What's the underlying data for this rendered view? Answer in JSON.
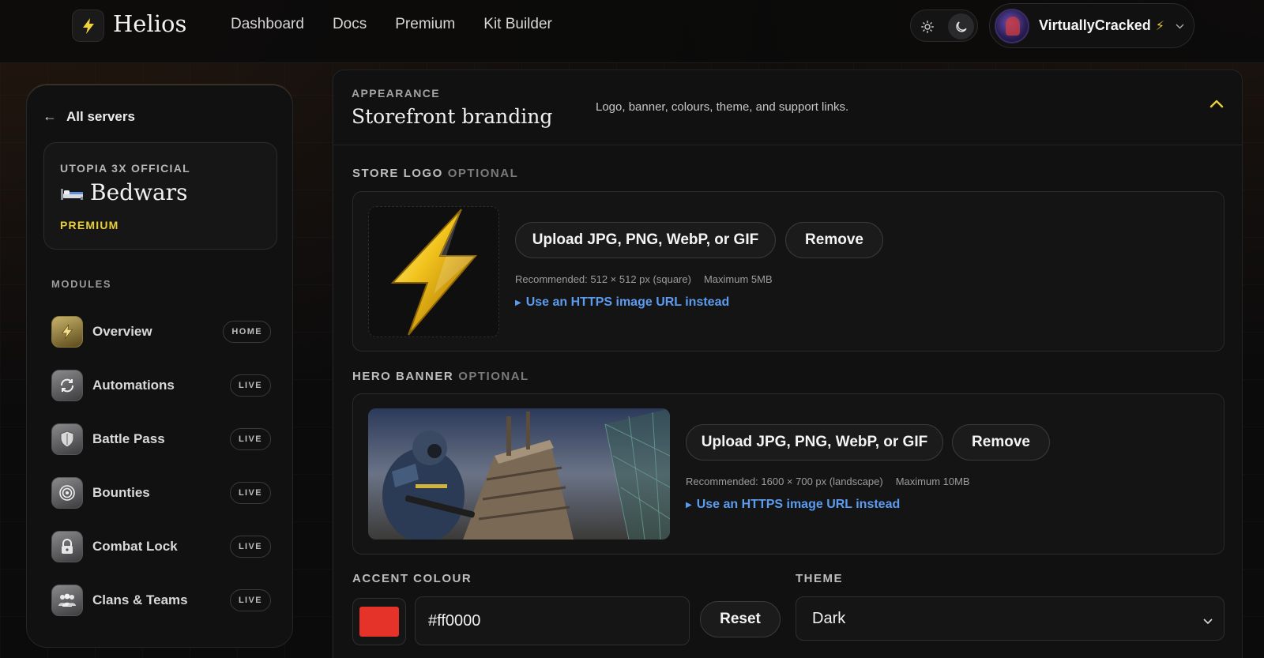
{
  "app": {
    "name": "Helios"
  },
  "nav": {
    "items": [
      "Dashboard",
      "Docs",
      "Premium",
      "Kit Builder"
    ]
  },
  "user": {
    "name": "VirtuallyCracked",
    "badge": "⚡"
  },
  "sidebar": {
    "back_label": "All servers",
    "server": {
      "org": "UTOPIA 3X OFFICIAL",
      "name": "Bedwars",
      "tier": "PREMIUM"
    },
    "modules_label": "MODULES",
    "modules": [
      {
        "label": "Overview",
        "badge": "HOME",
        "icon": "bolt-icon"
      },
      {
        "label": "Automations",
        "badge": "LIVE",
        "icon": "refresh-icon"
      },
      {
        "label": "Battle Pass",
        "badge": "LIVE",
        "icon": "shield-icon"
      },
      {
        "label": "Bounties",
        "badge": "LIVE",
        "icon": "target-icon"
      },
      {
        "label": "Combat Lock",
        "badge": "LIVE",
        "icon": "lock-icon"
      },
      {
        "label": "Clans & Teams",
        "badge": "LIVE",
        "icon": "people-icon"
      }
    ]
  },
  "panel": {
    "eyebrow": "APPEARANCE",
    "title": "Storefront branding",
    "description": "Logo, banner, colours, theme, and support links.",
    "store_logo": {
      "label": "STORE LOGO",
      "optional": "OPTIONAL",
      "upload_label": "Upload JPG, PNG, WebP, or GIF",
      "remove_label": "Remove",
      "recommended": "Recommended: 512 × 512 px (square)",
      "maximum": "Maximum 5MB",
      "url_link": "Use an HTTPS image URL instead"
    },
    "hero_banner": {
      "label": "HERO BANNER",
      "optional": "OPTIONAL",
      "upload_label": "Upload JPG, PNG, WebP, or GIF",
      "remove_label": "Remove",
      "recommended": "Recommended: 1600 × 700 px (landscape)",
      "maximum": "Maximum 10MB",
      "url_link": "Use an HTTPS image URL instead"
    },
    "accent": {
      "label": "ACCENT COLOUR",
      "value": "#ff0000",
      "swatch_color": "#e5332a",
      "reset_label": "Reset"
    },
    "theme": {
      "label": "THEME",
      "value": "Dark"
    }
  },
  "colors": {
    "accent_gold": "#e8cf3a",
    "link_blue": "#5b9cf0"
  }
}
